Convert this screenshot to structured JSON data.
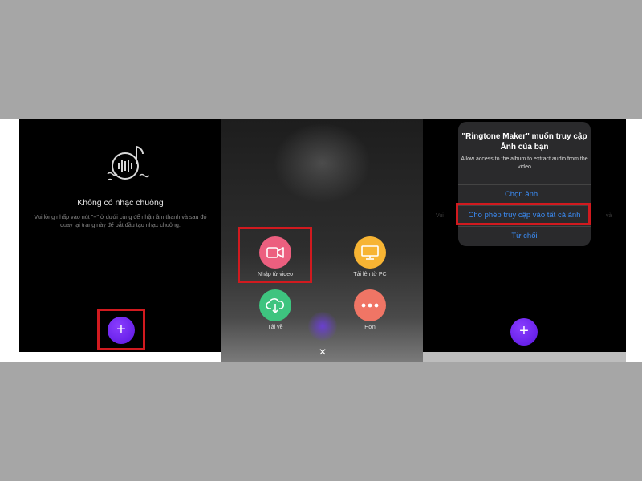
{
  "panel1": {
    "empty_title": "Không có nhạc chuông",
    "empty_description": "Vui lòng nhấp vào nút \"+\" ở dưới cùng để nhận âm thanh và sau đó quay lại trang này để bắt đầu tạo nhạc chuông.",
    "add_button_label": "+"
  },
  "panel2": {
    "menu": [
      {
        "label": "Nhập từ video",
        "icon": "video-camera-icon",
        "color": "#ec5f7f"
      },
      {
        "label": "Tải lên từ PC",
        "icon": "monitor-icon",
        "color": "#f7b433"
      },
      {
        "label": "Tải về",
        "icon": "cloud-download-icon",
        "color": "#3ec47f"
      },
      {
        "label": "Hơn",
        "icon": "more-dots-icon",
        "color": "#f07565"
      }
    ],
    "close_label": "×"
  },
  "panel3": {
    "alert": {
      "title": "\"Ringtone Maker\" muốn truy cập Ảnh của bạn",
      "message": "Allow access to the album to extract audio from the video",
      "options": [
        "Chọn ảnh...",
        "Cho phép truy cập vào tất cả ảnh",
        "Từ chối"
      ]
    },
    "background_hint_left": "Vui",
    "background_hint_right": "và",
    "add_button_label": "+"
  },
  "colors": {
    "highlight_red": "#d11a1f",
    "ios_blue": "#3b8cf5",
    "fab_purple": "#6a22f0"
  }
}
